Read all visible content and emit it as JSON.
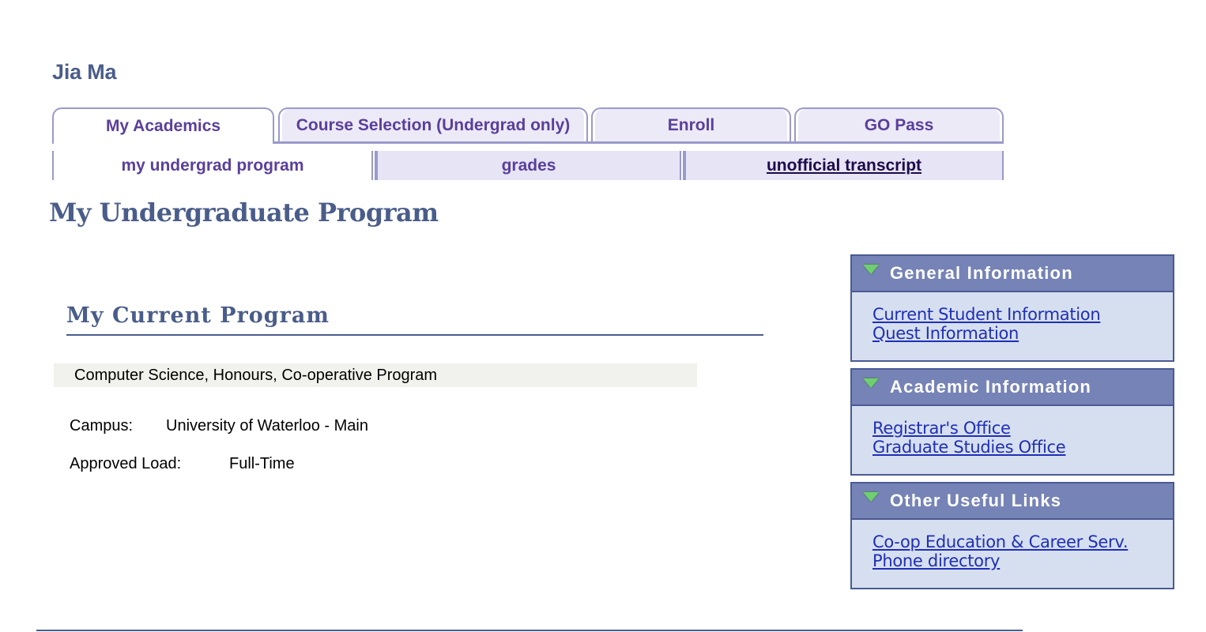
{
  "user": {
    "name": "Jia Ma"
  },
  "tabs": [
    {
      "label": "My Academics",
      "active": true
    },
    {
      "label": "Course Selection (Undergrad only)",
      "active": false
    },
    {
      "label": "Enroll",
      "active": false
    },
    {
      "label": "GO Pass",
      "active": false
    }
  ],
  "subtabs": [
    {
      "label": "my undergrad program",
      "active": true
    },
    {
      "label": "grades",
      "active": false
    },
    {
      "label": "unofficial transcript",
      "active": false
    }
  ],
  "page": {
    "title": "My Undergraduate Program"
  },
  "current_program": {
    "section_title": "My Current Program",
    "program": "Computer Science, Honours, Co-operative Program",
    "campus_label": "Campus:",
    "campus_value": "University of Waterloo - Main",
    "load_label": "Approved Load:",
    "load_value": "Full-Time"
  },
  "panels": [
    {
      "title": "General Information",
      "links": [
        "Current Student Information",
        "Quest Information"
      ]
    },
    {
      "title": "Academic Information",
      "links": [
        "Registrar's Office",
        "Graduate Studies Office"
      ]
    },
    {
      "title": "Other Useful Links",
      "links": [
        "Co-op Education & Career Serv.",
        "Phone directory"
      ]
    }
  ],
  "colors": {
    "heading": "#4a5d8a",
    "tab_text": "#5a3f9b",
    "panel_header": "#7683b6",
    "panel_body": "#d6dff0",
    "link": "#1f2fb5"
  },
  "icons": {
    "panel_toggle": "triangle-down-icon"
  }
}
